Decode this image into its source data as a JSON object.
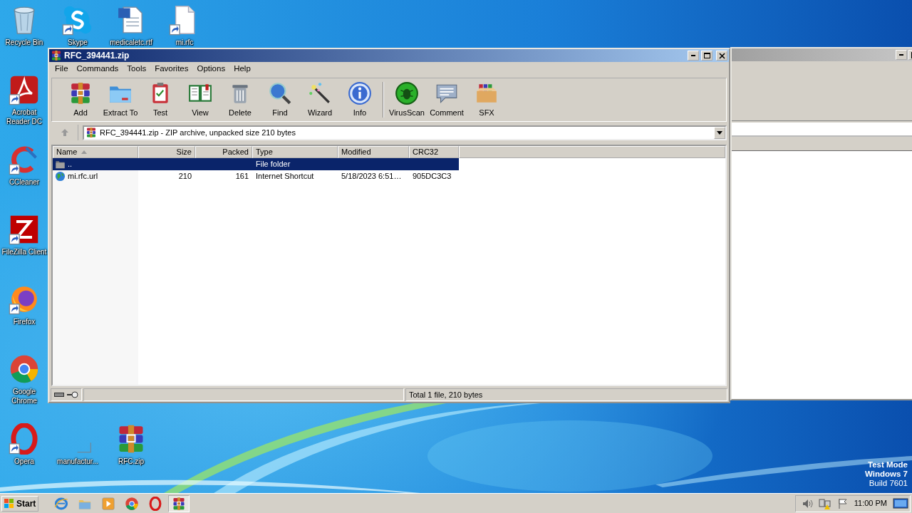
{
  "desktop_icons": [
    {
      "label": "Recycle Bin",
      "kind": "recycle",
      "shortcut": false
    },
    {
      "label": "Skype",
      "kind": "skype",
      "shortcut": true
    },
    {
      "label": "medicaletc.rtf",
      "kind": "word",
      "shortcut": false
    },
    {
      "label": "mi.rfc",
      "kind": "file",
      "shortcut": true
    },
    {
      "label": "Acrobat Reader DC",
      "kind": "acrobat",
      "shortcut": true
    },
    {
      "label": "CCleaner",
      "kind": "ccleaner",
      "shortcut": true
    },
    {
      "label": "FileZilla Client",
      "kind": "filezilla",
      "shortcut": true
    },
    {
      "label": "Firefox",
      "kind": "firefox",
      "shortcut": true
    },
    {
      "label": "Google Chrome",
      "kind": "chrome",
      "shortcut": false
    },
    {
      "label": "Opera",
      "kind": "opera",
      "shortcut": true
    },
    {
      "label": "manufactur...",
      "kind": "blank"
    },
    {
      "label": "RFC.zip",
      "kind": "archive",
      "shortcut": false
    }
  ],
  "window": {
    "title": "RFC_394441.zip",
    "menu": [
      "File",
      "Commands",
      "Tools",
      "Favorites",
      "Options",
      "Help"
    ],
    "toolbar": [
      {
        "label": "Add",
        "kind": "add"
      },
      {
        "label": "Extract To",
        "kind": "extract"
      },
      {
        "label": "Test",
        "kind": "test"
      },
      {
        "label": "View",
        "kind": "view"
      },
      {
        "label": "Delete",
        "kind": "delete"
      },
      {
        "label": "Find",
        "kind": "find"
      },
      {
        "label": "Wizard",
        "kind": "wizard"
      },
      {
        "label": "Info",
        "kind": "info"
      },
      {
        "label": "VirusScan",
        "kind": "virusscan"
      },
      {
        "label": "Comment",
        "kind": "comment"
      },
      {
        "label": "SFX",
        "kind": "sfx"
      }
    ],
    "address": "RFC_394441.zip - ZIP archive, unpacked size 210 bytes",
    "columns": [
      {
        "label": "Name",
        "kind": "text",
        "sorted": true
      },
      {
        "label": "Size",
        "kind": "number",
        "sorted": false
      },
      {
        "label": "Packed",
        "kind": "number",
        "sorted": false
      },
      {
        "label": "Type",
        "kind": "text",
        "sorted": false
      },
      {
        "label": "Modified",
        "kind": "text",
        "sorted": false
      },
      {
        "label": "CRC32",
        "kind": "text",
        "sorted": false
      }
    ],
    "rows": [
      {
        "kind": "folder",
        "selected": true,
        "cells": [
          "..",
          "",
          "",
          "File folder",
          "",
          ""
        ]
      },
      {
        "kind": "url",
        "selected": false,
        "cells": [
          "mi.rfc.url",
          "210",
          "161",
          "Internet Shortcut",
          "5/18/2023 6:51…",
          "905DC3C3"
        ]
      }
    ],
    "status": "Total 1 file, 210 bytes"
  },
  "os_notice": [
    {
      "text": "Test Mode",
      "bold": true
    },
    {
      "text": "Windows 7",
      "bold": true
    },
    {
      "text": "Build 7601",
      "bold": false
    }
  ],
  "taskbar": {
    "start": "Start",
    "apps": [
      {
        "kind": "ie",
        "active": false
      },
      {
        "kind": "explorer",
        "active": false
      },
      {
        "kind": "media",
        "active": false
      },
      {
        "kind": "chrome",
        "active": false
      },
      {
        "kind": "opera",
        "active": false
      },
      {
        "kind": "archive",
        "active": true
      }
    ],
    "clock": "11:00 PM"
  }
}
